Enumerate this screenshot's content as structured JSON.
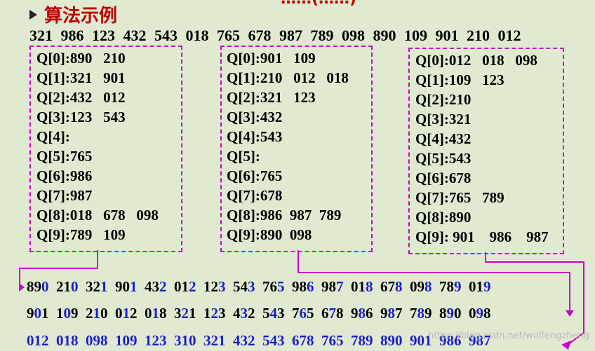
{
  "title": "算法示例",
  "top_fragment": "……(……)",
  "input_sequence": "321 986 123 432 543 018 765 678 987 789 098 890 109 901 210 012",
  "pass1_queues": [
    "Q[0]:890   210",
    "Q[1]:321   901",
    "Q[2]:432   012",
    "Q[3]:123   543",
    "Q[4]:",
    "Q[5]:765",
    "Q[6]:986",
    "Q[7]:987",
    "Q[8]:018   678   098",
    "Q[9]:789   109"
  ],
  "pass2_queues": [
    "Q[0]:901   109",
    "Q[1]:210   012   018",
    "Q[2]:321   123",
    "Q[3]:432",
    "Q[4]:543",
    "Q[5]:",
    "Q[6]:765",
    "Q[7]:678",
    "Q[8]:986  987  789",
    "Q[9]:890  098"
  ],
  "pass3_queues": [
    "Q[0]:012   018   098",
    "Q[1]:109   123",
    "Q[2]:210",
    "Q[3]:321",
    "Q[4]:432",
    "Q[5]:543",
    "Q[6]:678",
    "Q[7]:765   789",
    "Q[8]:890",
    "Q[9]: 901    986    987"
  ],
  "output_pass1": [
    "890",
    "210",
    "321",
    "901",
    "432",
    "012",
    "123",
    "543",
    "765",
    "986",
    "987",
    "018",
    "678",
    "098",
    "789",
    "019"
  ],
  "output_pass2": [
    "901",
    "109",
    "210",
    "012",
    "018",
    "321",
    "123",
    "432",
    "543",
    "765",
    "678",
    "986",
    "987",
    "789",
    "890",
    "098"
  ],
  "output_pass3": [
    "012",
    "018",
    "098",
    "109",
    "123",
    "310",
    "321",
    "432",
    "543",
    "678",
    "765",
    "789",
    "890",
    "901",
    "986",
    "987"
  ],
  "watermark": "https://blog.csdn.net/wolfengzheng",
  "colors": {
    "title": "#c00000",
    "box_border": "#cc00cc",
    "connector": "#cc00cc",
    "highlight": "#1c1ccd",
    "background": "#dfead0"
  }
}
